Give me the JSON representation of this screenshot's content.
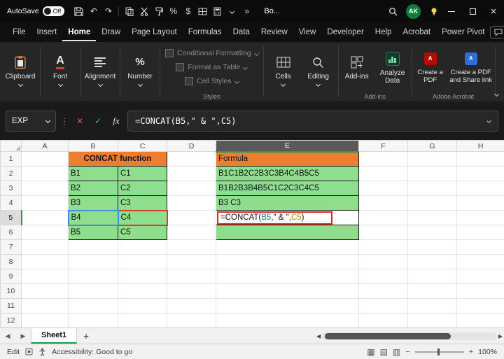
{
  "colors": {
    "orange-fill": "#ED7D31",
    "green-fill": "#8EDE8E",
    "ref-blue": "#2E75B6",
    "ref-gold": "#BF8F00",
    "annotation-red": "#E0261B",
    "excel-green": "#1E9E50"
  },
  "titlebar": {
    "autosave_label": "AutoSave",
    "autosave_state": "Off",
    "workbook_name": "Bo...",
    "avatar_initials": "AK"
  },
  "menubar": {
    "tabs": [
      "File",
      "Insert",
      "Home",
      "Draw",
      "Page Layout",
      "Formulas",
      "Data",
      "Review",
      "View",
      "Developer",
      "Help",
      "Acrobat",
      "Power Pivot"
    ]
  },
  "ribbon": {
    "big_buttons": [
      {
        "label": "Clipboard"
      },
      {
        "label": "Font"
      },
      {
        "label": "Alignment"
      },
      {
        "label": "Number"
      }
    ],
    "styles_group": {
      "items": [
        "Conditional Formatting",
        "Format as Table",
        "Cell Styles"
      ],
      "label": "Styles"
    },
    "cells_label": "Cells",
    "editing_label": "Editing",
    "addins_group": {
      "addins_label": "Add-ins",
      "analyze_label": "Analyze Data",
      "label": "Add-ins"
    },
    "acrobat_group": {
      "pdf_label": "Create a PDF",
      "share_label": "Create a PDF and Share link",
      "label": "Adobe Acrobat"
    }
  },
  "formula_bar": {
    "name_box": "EXP",
    "fx_label": "fx",
    "formula": "=CONCAT(B5,\" & \",C5)"
  },
  "grid": {
    "columns": [
      "A",
      "B",
      "C",
      "D",
      "E",
      "F",
      "G",
      "H"
    ],
    "row_numbers": [
      "1",
      "2",
      "3",
      "4",
      "5",
      "6",
      "7",
      "8",
      "9",
      "10",
      "11",
      "12"
    ],
    "cells": {
      "title": "CONCAT function",
      "formula_header": "Formula",
      "col_b": [
        "B1",
        "B2",
        "B3",
        "B4",
        "B5"
      ],
      "col_c": [
        "C1",
        "C2",
        "C3",
        "C4",
        "C5"
      ],
      "e2": "B1C1B2C2B3C3B4C4B5C5",
      "e3": "B1B2B3B4B5C1C2C3C4C5",
      "e4": "B3 C3",
      "e5": {
        "prefix": "=CONCAT(",
        "ref1": "B5",
        "mid": ",\" & \",",
        "ref2": "C5",
        "suffix": ")"
      }
    }
  },
  "sheet_tabs": {
    "tabs": [
      "Sheet1"
    ]
  },
  "status_bar": {
    "mode": "Edit",
    "accessibility": "Accessibility: Good to go",
    "zoom": "100%"
  }
}
